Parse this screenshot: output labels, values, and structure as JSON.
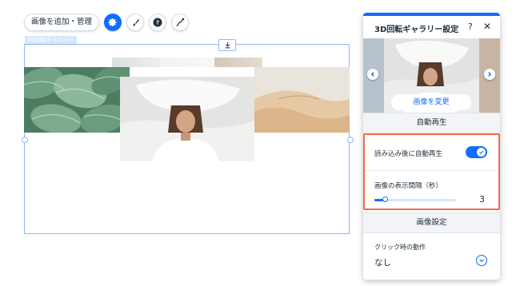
{
  "toolbar": {
    "manage_label": "画像を追加・管理",
    "icons": [
      "settings-gear-icon",
      "design-brush-icon",
      "help-icon",
      "animation-icon"
    ]
  },
  "component": {
    "tag_label": "3D回転ギャラリー"
  },
  "panel": {
    "title": "3D回転ギャラリー設定",
    "help": "?",
    "close": "✕",
    "change_image_label": "画像を変更",
    "autoplay_section": "自動再生",
    "autoplay_label": "読み込み後に自動再生",
    "autoplay_on": true,
    "interval_label": "画像の表示間隔（秒）",
    "interval_value": "3",
    "interval_fraction": 0.13,
    "image_settings_section": "画像設定",
    "click_action_label": "クリック時の動作",
    "click_action_value": "なし"
  },
  "colors": {
    "accent": "#116dff",
    "highlight": "#f06b4f"
  }
}
